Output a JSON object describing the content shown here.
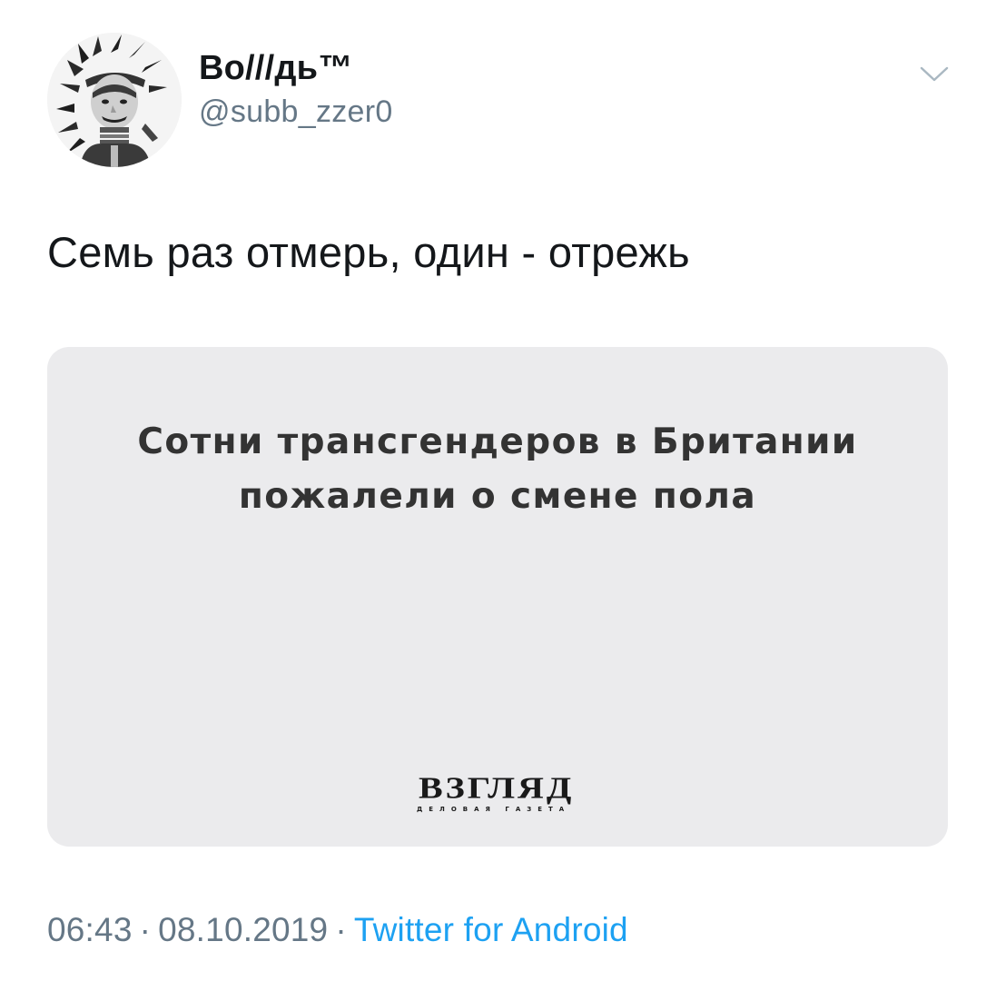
{
  "tweet": {
    "author": {
      "display_name": "Во///дь™",
      "handle": "@subb_zzer0",
      "avatar": "avatar-portrait-in-headdress"
    },
    "menu_icon": "chevron-down-icon",
    "text": "Семь раз отмерь, один - отрежь",
    "card": {
      "headline_line1": "Сотни трансгендеров в Британии",
      "headline_line2": "пожалели о смене пола",
      "publisher_logo": "ВЗГЛЯД",
      "publisher_tagline": "ДЕЛОВАЯ ГАЗЕТА"
    },
    "meta": {
      "time": "06:43",
      "separator": "·",
      "date": "08.10.2019",
      "source": "Twitter for Android"
    }
  },
  "colors": {
    "text_primary": "#14171a",
    "text_secondary": "#657786",
    "link": "#1da1f2",
    "card_background": "#ebebed",
    "headline": "#333333"
  }
}
